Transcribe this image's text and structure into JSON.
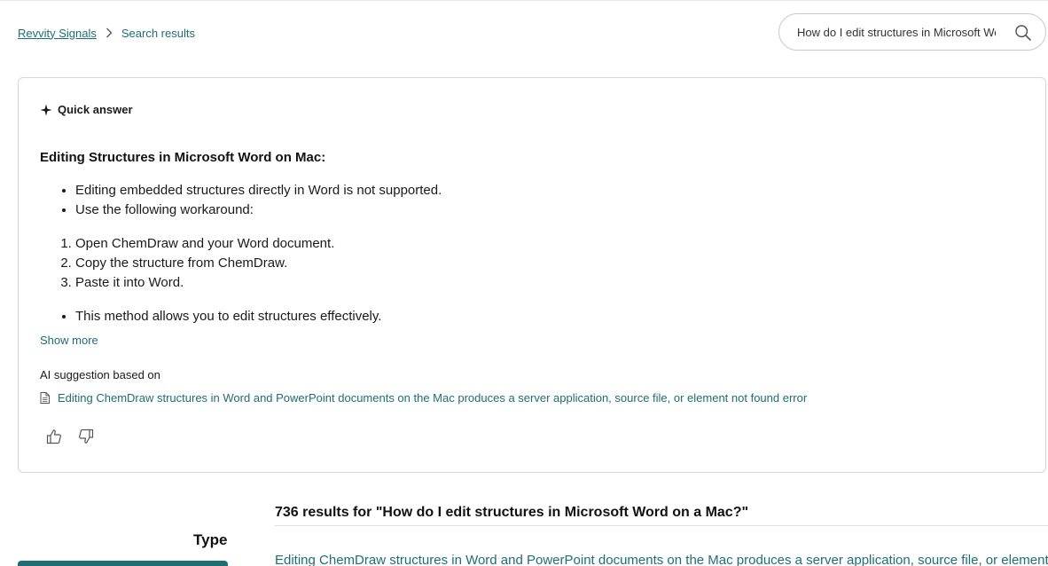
{
  "breadcrumb": {
    "home": "Revvity Signals",
    "current": "Search results"
  },
  "search": {
    "value": "How do I edit structures in Microsoft Word on a Mac?",
    "icon": "search-icon"
  },
  "quick_answer": {
    "heading": "Quick answer",
    "title": "Editing Structures in Microsoft Word on Mac:",
    "bullets_top": [
      "Editing embedded structures directly in Word is not supported.",
      "Use the following workaround:"
    ],
    "steps": [
      "Open ChemDraw and your Word document.",
      "Copy the structure from ChemDraw.",
      "Paste it into Word."
    ],
    "bullets_bottom": [
      "This method allows you to edit structures effectively."
    ],
    "show_more": "Show more",
    "ai_based_on": "AI suggestion based on",
    "source_title": "Editing ChemDraw structures in Word and PowerPoint documents on the Mac produces a server application, source file, or element not found error"
  },
  "results": {
    "heading": "736 results for \"How do I edit structures in Microsoft Word on a Mac?\"",
    "first_title": "Editing ChemDraw structures in Word and PowerPoint documents on the Mac produces a server application, source file, or element not found error"
  },
  "filters": {
    "type_label": "Type"
  },
  "colors": {
    "accent": "#1d6f74",
    "border": "#d6d6d6",
    "text": "#1a1a1a"
  }
}
